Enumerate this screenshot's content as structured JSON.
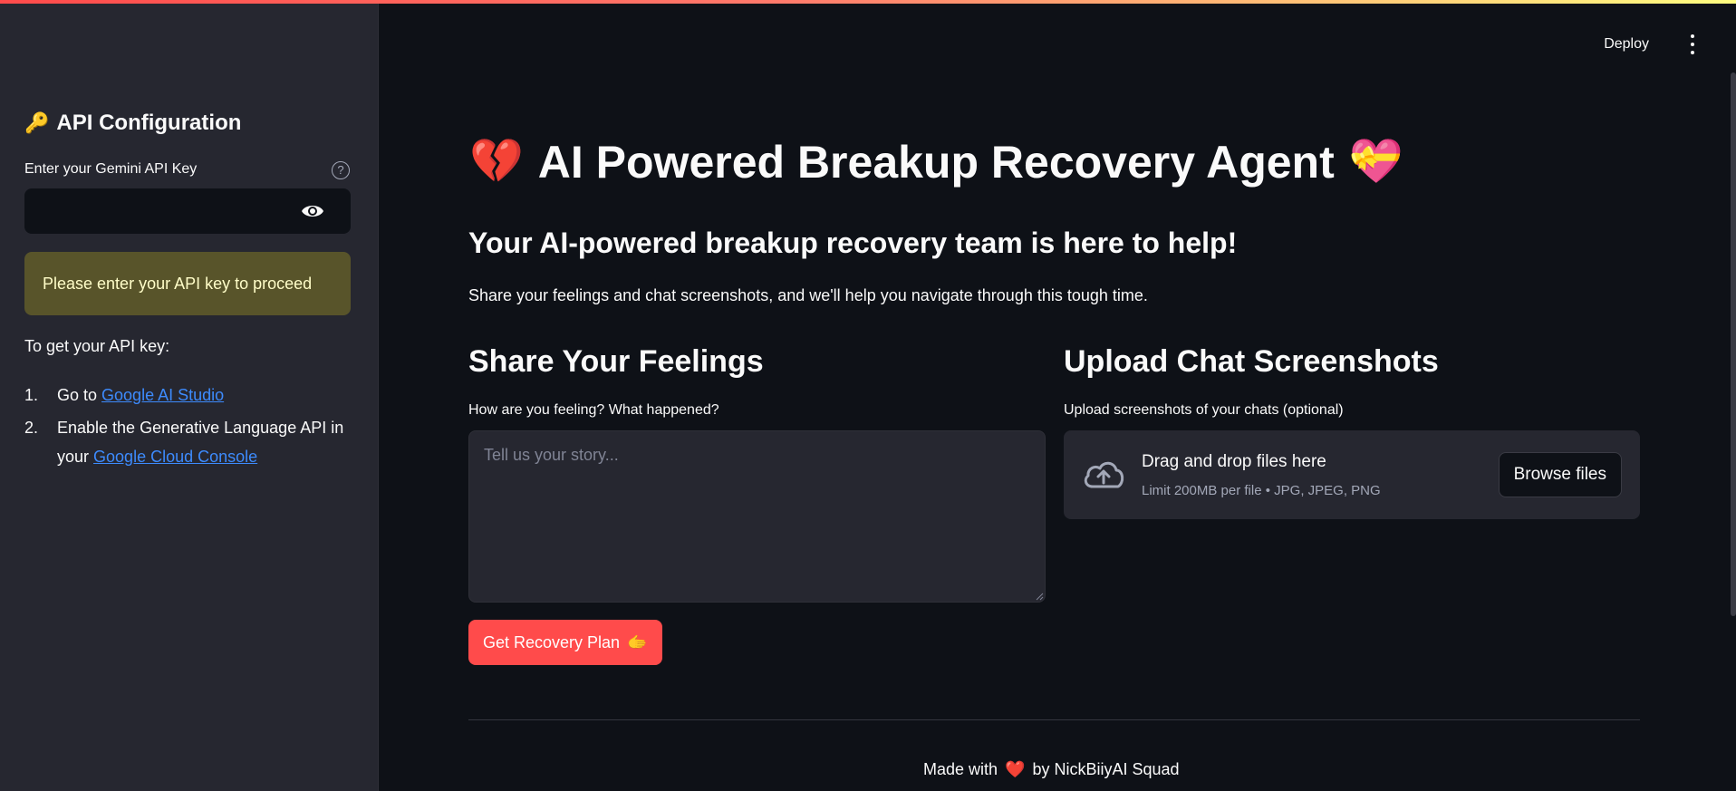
{
  "header": {
    "deploy_label": "Deploy"
  },
  "sidebar": {
    "title_icon": "🔑",
    "title": "API Configuration",
    "api_key_label": "Enter your Gemini API Key",
    "api_key_value": "",
    "warning": "Please enter your API key to proceed",
    "get_key_heading": "To get your API key:",
    "steps": [
      {
        "num": "1.",
        "prefix": "Go to ",
        "link": "Google AI Studio",
        "suffix": ""
      },
      {
        "num": "2.",
        "prefix": "Enable the Generative Language API in your ",
        "link": "Google Cloud Console",
        "suffix": ""
      }
    ]
  },
  "main": {
    "title_left_emoji": "💔",
    "title": "AI Powered Breakup Recovery Agent",
    "title_right_emoji": "💝",
    "subheading": "Your AI-powered breakup recovery team is here to help!",
    "lead": "Share your feelings and chat screenshots, and we'll help you navigate through this tough time.",
    "feelings": {
      "title": "Share Your Feelings",
      "label": "How are you feeling? What happened?",
      "placeholder": "Tell us your story..."
    },
    "upload": {
      "title": "Upload Chat Screenshots",
      "label": "Upload screenshots of your chats (optional)",
      "drop_title": "Drag and drop files here",
      "drop_limit": "Limit 200MB per file • JPG, JPEG, PNG",
      "browse_label": "Browse files"
    },
    "recover_button": "Get Recovery Plan",
    "recover_button_emoji": "🫱",
    "footer": {
      "prefix": "Made with",
      "heart": "❤️",
      "suffix": "by NickBiiyAI Squad"
    }
  }
}
